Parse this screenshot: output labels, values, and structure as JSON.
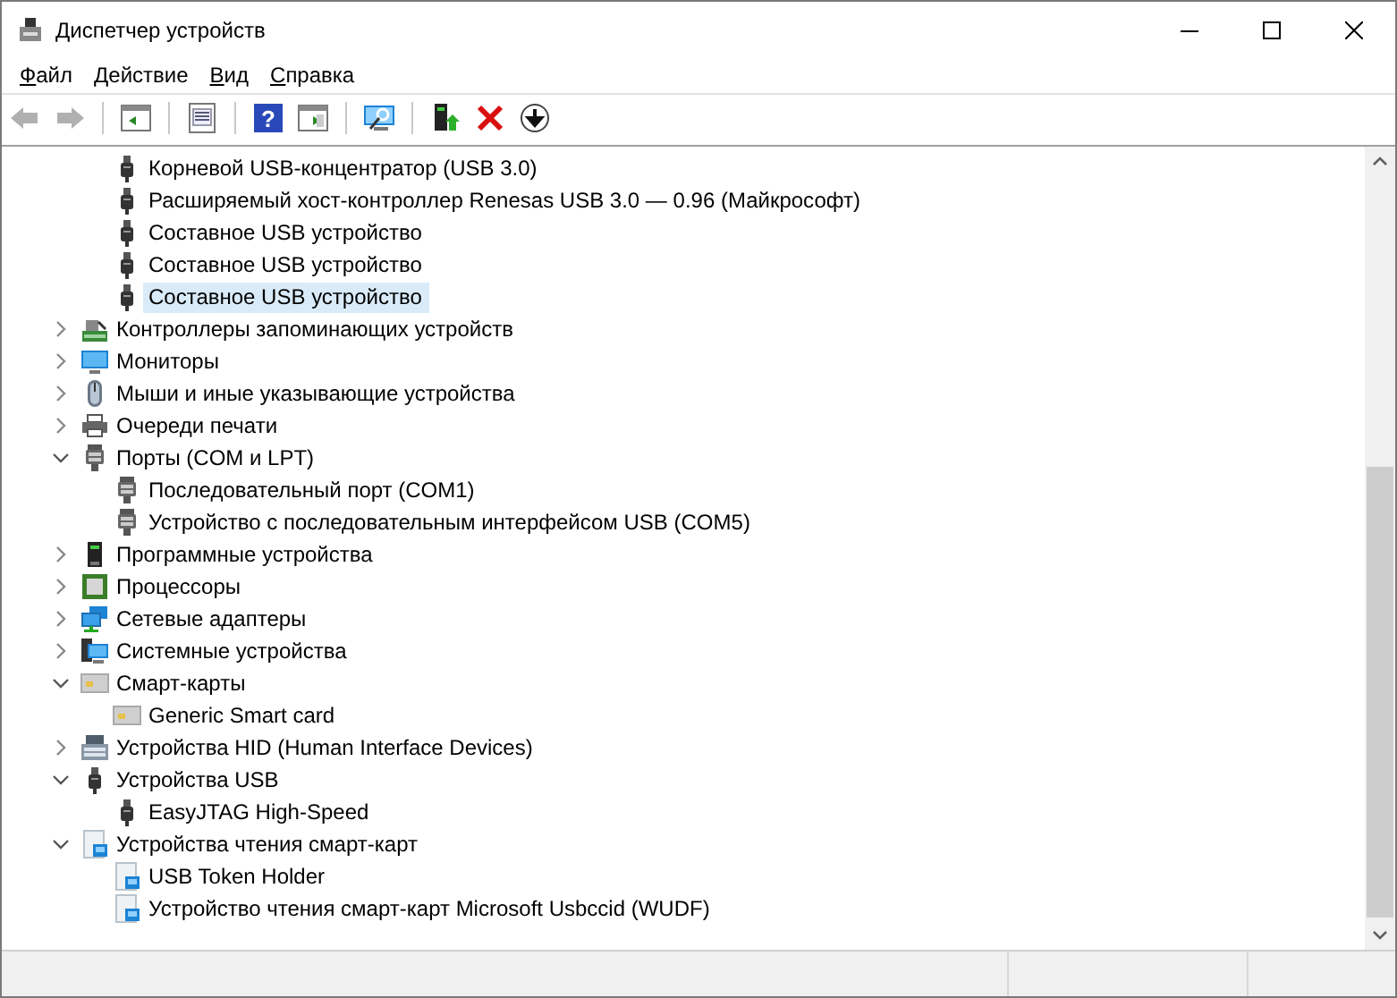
{
  "window": {
    "title": "Диспетчер устройств"
  },
  "menu": [
    {
      "label": "Файл"
    },
    {
      "label": "Действие"
    },
    {
      "label": "Вид"
    },
    {
      "label": "Справка"
    }
  ],
  "toolbar": [
    {
      "kind": "back",
      "disabled": true
    },
    {
      "kind": "forward",
      "disabled": true
    },
    {
      "kind": "sep"
    },
    {
      "kind": "panel",
      "disabled": false
    },
    {
      "kind": "sep"
    },
    {
      "kind": "properties",
      "disabled": false
    },
    {
      "kind": "sep"
    },
    {
      "kind": "help",
      "glyph": "?",
      "disabled": false
    },
    {
      "kind": "panel2",
      "disabled": false
    },
    {
      "kind": "sep"
    },
    {
      "kind": "scan",
      "disabled": false
    },
    {
      "kind": "sep"
    },
    {
      "kind": "update",
      "disabled": false
    },
    {
      "kind": "remove",
      "disabled": false
    },
    {
      "kind": "disable",
      "disabled": false
    }
  ],
  "tree_scrolled_children": [
    {
      "label": "Корневой USB-концентратор (USB 3.0)",
      "kind": "usb",
      "selected": false
    },
    {
      "label": "Расширяемый хост-контроллер Renesas USB 3.0 — 0.96 (Майкрософт)",
      "kind": "usb",
      "selected": false
    },
    {
      "label": "Составное USB устройство",
      "kind": "usb",
      "selected": false
    },
    {
      "label": "Составное USB устройство",
      "kind": "usb",
      "selected": false
    },
    {
      "label": "Составное USB устройство",
      "kind": "usb",
      "selected": true
    }
  ],
  "tree": [
    {
      "label": "Контроллеры запоминающих устройств",
      "kind": "storage",
      "expanded": false,
      "selected": false
    },
    {
      "label": "Мониторы",
      "kind": "monitor",
      "expanded": false,
      "selected": false
    },
    {
      "label": "Мыши и иные указывающие устройства",
      "kind": "mouse",
      "expanded": false,
      "selected": false
    },
    {
      "label": "Очереди печати",
      "kind": "printer",
      "expanded": false,
      "selected": false
    },
    {
      "label": "Порты (COM и LPT)",
      "kind": "port",
      "expanded": true,
      "selected": false,
      "children": [
        {
          "label": "Последовательный порт (COM1)",
          "kind": "port",
          "selected": false
        },
        {
          "label": "Устройство с последовательным интерфейсом USB (COM5)",
          "kind": "port",
          "selected": false
        }
      ]
    },
    {
      "label": "Программные устройства",
      "kind": "software",
      "expanded": false,
      "selected": false
    },
    {
      "label": "Процессоры",
      "kind": "cpu",
      "expanded": false,
      "selected": false
    },
    {
      "label": "Сетевые адаптеры",
      "kind": "network",
      "expanded": false,
      "selected": false
    },
    {
      "label": "Системные устройства",
      "kind": "system",
      "expanded": false,
      "selected": false
    },
    {
      "label": "Смарт-карты",
      "kind": "smartcard",
      "expanded": true,
      "selected": false,
      "children": [
        {
          "label": "Generic Smart card",
          "kind": "smartcard",
          "selected": false
        }
      ]
    },
    {
      "label": "Устройства HID (Human Interface Devices)",
      "kind": "hid",
      "expanded": false,
      "selected": false
    },
    {
      "label": "Устройства USB",
      "kind": "usb",
      "expanded": true,
      "selected": false,
      "children": [
        {
          "label": "EasyJTAG High-Speed",
          "kind": "usb",
          "selected": false
        }
      ]
    },
    {
      "label": "Устройства чтения смарт-карт",
      "kind": "reader",
      "expanded": true,
      "selected": false,
      "children": [
        {
          "label": "USB Token Holder",
          "kind": "reader",
          "selected": false
        },
        {
          "label": "Устройство чтения смарт-карт Microsoft Usbccid (WUDF)",
          "kind": "reader",
          "selected": false
        }
      ]
    }
  ]
}
